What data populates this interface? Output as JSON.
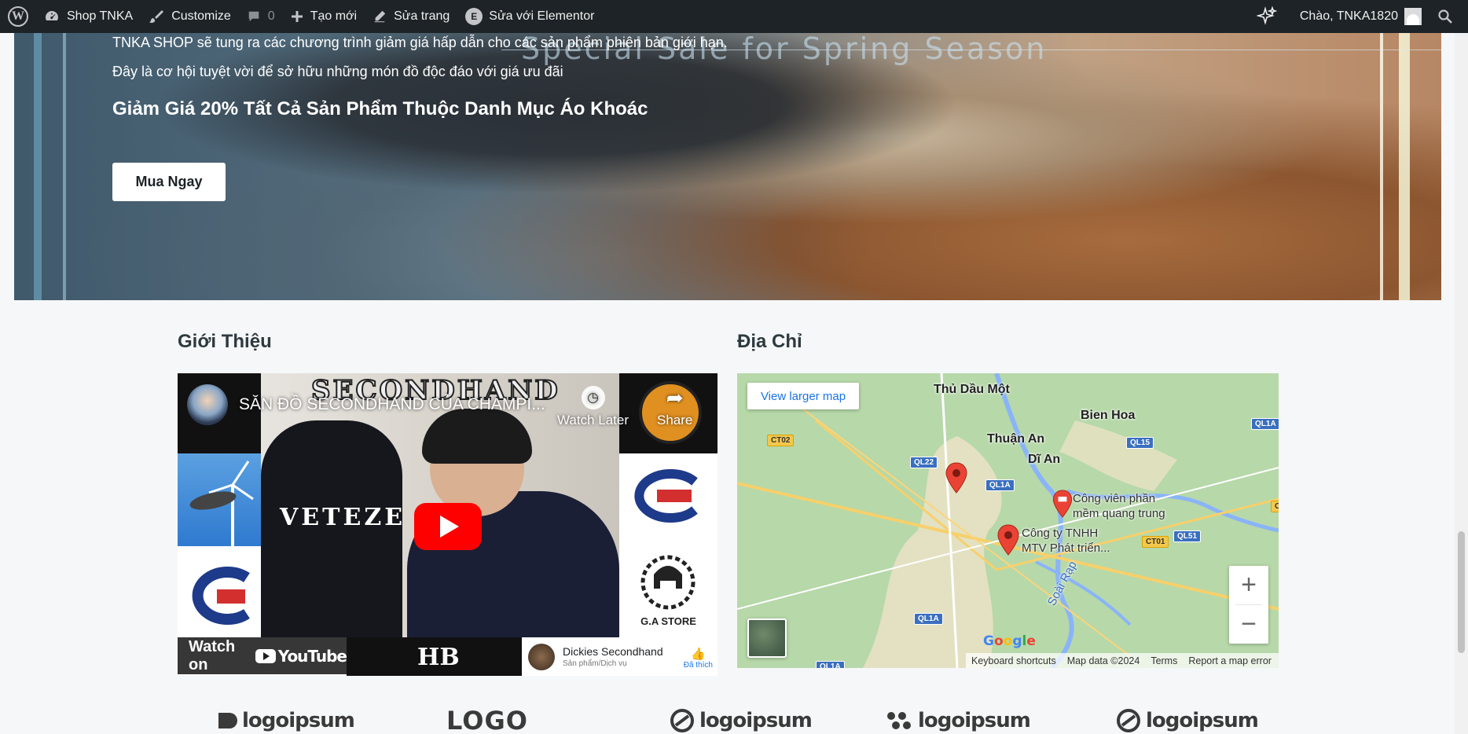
{
  "admin_bar": {
    "site_name": "Shop TNKA",
    "customize": "Customize",
    "comments_count": "0",
    "new": "Tạo mới",
    "edit_page": "Sửa trang",
    "edit_elementor": "Sửa với Elementor",
    "greeting": "Chào, TNKA1820",
    "icons": [
      "wordpress-icon",
      "dashboard-icon",
      "brush-icon",
      "comment-icon",
      "plus-icon",
      "pencil-icon",
      "elementor-icon",
      "sparkle-icon",
      "search-icon"
    ]
  },
  "hero": {
    "watermark": "Special Sale for Spring Season",
    "text": "TNKA SHOP sẽ tung ra các chương trình giảm giá hấp dẫn cho các sản phẩm phiên bản giới hạn. Đây là cơ hội tuyệt vời để sở hữu những món đồ độc đáo với giá ưu đãi",
    "headline": "Giảm Giá 20% Tất Cả Sản Phẩm Thuộc Danh Mục Áo Khoác",
    "cta": "Mua Ngay"
  },
  "intro": {
    "title": "Giới Thiệu",
    "video": {
      "title": "SĂN ĐỒ SECONDHAND CỦA CHAMPI...",
      "overlay_brand": "SECONDHAND",
      "watch_later": "Watch Later",
      "share": "Share",
      "watch_on": "Watch on",
      "youtube": "YouTube",
      "shirt_text": "VETEZE",
      "store_label": "G.A STORE",
      "fb_name": "Dickies Secondhand",
      "fb_sub": "Sản phẩm/Dịch vụ",
      "fb_like": "Đã thích"
    }
  },
  "address": {
    "title": "Địa Chỉ",
    "map": {
      "view_larger": "View larger map",
      "places": [
        "Thủ Dầu Một",
        "Bien Hoa",
        "Thuận An",
        "Dĩ An"
      ],
      "poi_1": [
        "Công viên phần",
        "mềm quang trung"
      ],
      "poi_2": [
        "Công ty TNHH",
        "MTV Phát triển..."
      ],
      "roads": [
        "CT02",
        "QL22",
        "QL1A",
        "QL15",
        "QL1A",
        "QL51",
        "CT01",
        "QL1A",
        "QL1A",
        "CT"
      ],
      "river": "Soài Rạp",
      "google": "Google",
      "footer": [
        "Keyboard shortcuts",
        "Map data ©2024",
        "Terms",
        "Report a map error"
      ]
    }
  },
  "logos": [
    "logoipsum",
    "LOGO",
    "logoipsum",
    "logoipsum",
    "logoipsum"
  ],
  "colors": {
    "admin_bar": "#1d2327",
    "youtube_red": "#ff0000",
    "map_link": "#1a73e8",
    "pin_red": "#ea4335"
  }
}
